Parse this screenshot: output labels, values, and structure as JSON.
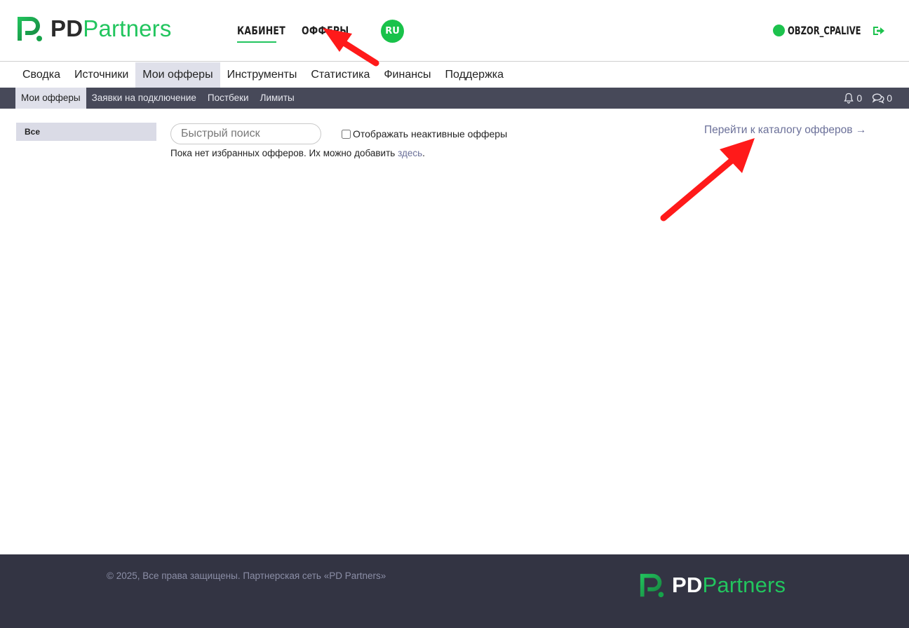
{
  "brand": {
    "pd": "PD",
    "partners": "Partners"
  },
  "topnav": {
    "cabinet": "КАБИНЕТ",
    "offers": "ОФФЕРЫ",
    "lang": "RU"
  },
  "user": {
    "name": "OBZOR_CPALIVE"
  },
  "mainnav": {
    "items": [
      {
        "label": "Сводка"
      },
      {
        "label": "Источники"
      },
      {
        "label": "Мои офферы",
        "active": true
      },
      {
        "label": "Инструменты"
      },
      {
        "label": "Статистика"
      },
      {
        "label": "Финансы"
      },
      {
        "label": "Поддержка"
      }
    ]
  },
  "subnav": {
    "items": [
      {
        "label": "Мои офферы",
        "active": true
      },
      {
        "label": "Заявки на подключение"
      },
      {
        "label": "Постбеки"
      },
      {
        "label": "Лимиты"
      }
    ],
    "notifications_count": "0",
    "messages_count": "0"
  },
  "content": {
    "side_tab": "Все",
    "search_placeholder": "Быстрый поиск",
    "inactive_label": "Отображать неактивные офферы",
    "empty_text": "Пока нет избранных офферов. Их можно добавить ",
    "empty_link": "здесь",
    "empty_end": ".",
    "catalog_link": "Перейти к каталогу офферов →"
  },
  "footer": {
    "copyright": "© 2025, Все права защищены. Партнерская сеть «PD Partners»"
  },
  "colors": {
    "accent": "#22c55e",
    "subnav_bg": "#474959",
    "footer_bg": "#333443",
    "link": "#6b7099",
    "annotation": "#ff1a1a"
  }
}
